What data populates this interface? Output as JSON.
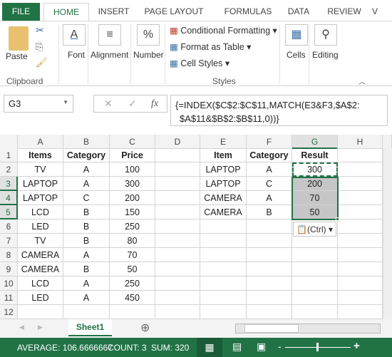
{
  "ribbon_tabs": [
    "FILE",
    "HOME",
    "INSERT",
    "PAGE LAYOUT",
    "FORMULAS",
    "DATA",
    "REVIEW",
    "V"
  ],
  "clipboard": {
    "paste": "Paste",
    "label": "Clipboard"
  },
  "groups": {
    "font": "Font",
    "alignment": "Alignment",
    "number": "Number",
    "cells": "Cells",
    "editing": "Editing",
    "styles": "Styles"
  },
  "styles": {
    "conditional": "Conditional Formatting",
    "table": "Format as Table",
    "cell_styles": "Cell Styles"
  },
  "formula_bar": {
    "name_box": "G3",
    "fx": "fx",
    "formula_line1": "{=INDEX($C$2:$C$11,MATCH(E3&F3,$A$2:",
    "formula_line2": "$A$11&$B$2:$B$11,0))}"
  },
  "columns": [
    "A",
    "B",
    "C",
    "D",
    "E",
    "F",
    "G",
    "H"
  ],
  "rows": [
    "1",
    "2",
    "3",
    "4",
    "5",
    "6",
    "7",
    "8",
    "9",
    "10",
    "11",
    "12"
  ],
  "headers": {
    "A": "Items",
    "B": "Category",
    "C": "Price",
    "E": "Item",
    "F": "Category",
    "G": "Result"
  },
  "data": [
    [
      "TV",
      "A",
      "100"
    ],
    [
      "LAPTOP",
      "A",
      "300"
    ],
    [
      "LAPTOP",
      "C",
      "200"
    ],
    [
      "LCD",
      "B",
      "150"
    ],
    [
      "LED",
      "B",
      "250"
    ],
    [
      "TV",
      "B",
      "80"
    ],
    [
      "CAMERA",
      "A",
      "70"
    ],
    [
      "CAMERA",
      "B",
      "50"
    ],
    [
      "LCD",
      "A",
      "250"
    ],
    [
      "LED",
      "A",
      "450"
    ]
  ],
  "lookup": [
    [
      "LAPTOP",
      "A",
      "300"
    ],
    [
      "LAPTOP",
      "C",
      "200"
    ],
    [
      "CAMERA",
      "A",
      "70"
    ],
    [
      "CAMERA",
      "B",
      "50"
    ]
  ],
  "paste_options": "(Ctrl)",
  "sheet_tab": "Sheet1",
  "status": {
    "average": "AVERAGE: 106.6666667",
    "count": "COUNT: 3",
    "sum": "SUM: 320"
  },
  "colors": {
    "accent": "#217346",
    "selection": "#c6c6c6"
  }
}
